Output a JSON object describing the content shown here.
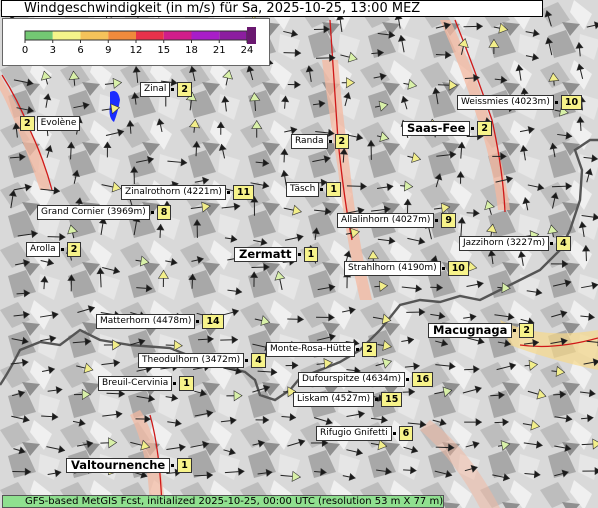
{
  "title": "Windgeschwindigkeit (in m/s) für Sa, 2025-10-25, 13:00 MEZ",
  "footer": "GFS-based MetGIS Fcst, initialized 2025-10-25, 00:00 UTC  (resolution 53 m X 77 m)",
  "legend": {
    "ticks": [
      "0",
      "3",
      "6",
      "9",
      "12",
      "15",
      "18",
      "21",
      "24"
    ],
    "colors": [
      "#73c873",
      "#f5f58a",
      "#f5c35a",
      "#f08a3c",
      "#e8324b",
      "#d01e8a",
      "#a81ec8",
      "#8c1ea0"
    ]
  },
  "places": [
    {
      "name": "Zinal",
      "value": "2",
      "big": false
    },
    {
      "name": "Evolène",
      "value": "2",
      "big": false,
      "value_first": true
    },
    {
      "name": "Weissmies (4023m)",
      "value": "10",
      "big": false
    },
    {
      "name": "Saas-Fee",
      "value": "2",
      "big": true
    },
    {
      "name": "Randa",
      "value": "2",
      "big": false
    },
    {
      "name": "Täsch",
      "value": "1",
      "big": false
    },
    {
      "name": "Zinalrothorn (4221m)",
      "value": "11",
      "big": false
    },
    {
      "name": "Grand Cornier (3969m)",
      "value": "8",
      "big": false
    },
    {
      "name": "Allalinhorn (4027m)",
      "value": "9",
      "big": false
    },
    {
      "name": "Arolla",
      "value": "2",
      "big": false
    },
    {
      "name": "Jazzihorn (3227m)",
      "value": "4",
      "big": false
    },
    {
      "name": "Zermatt",
      "value": "1",
      "big": true
    },
    {
      "name": "Strahlhorn (4190m)",
      "value": "10",
      "big": false
    },
    {
      "name": "Matterhorn (4478m)",
      "value": "14",
      "big": false
    },
    {
      "name": "Macugnaga",
      "value": "2",
      "big": true
    },
    {
      "name": "Monte-Rosa-Hütte",
      "value": "2",
      "big": false
    },
    {
      "name": "Theodulhorn (3472m)",
      "value": "4",
      "big": false
    },
    {
      "name": "Breuil-Cervinia",
      "value": "1",
      "big": false
    },
    {
      "name": "Dufourspitze (4634m)",
      "value": "16",
      "big": false
    },
    {
      "name": "Liskam (4527m)",
      "value": "15",
      "big": false
    },
    {
      "name": "Rifugio Gnifetti",
      "value": "6",
      "big": false
    },
    {
      "name": "Valtournenche",
      "value": "1",
      "big": true
    }
  ]
}
